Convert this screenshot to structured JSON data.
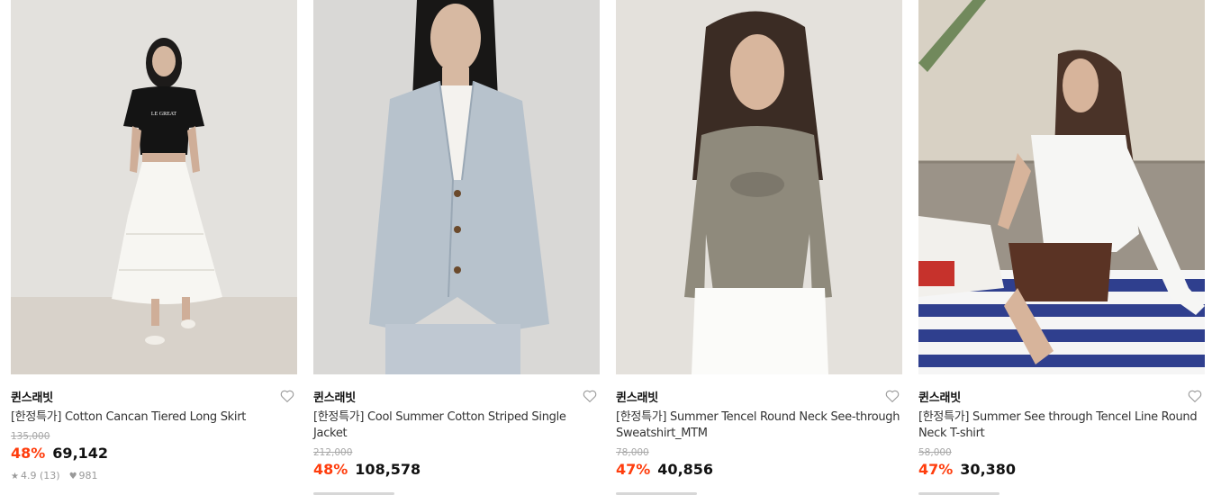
{
  "products": [
    {
      "brand": "퀸스래빗",
      "title": "[한정특가] Cotton Cancan Tiered Long Skirt",
      "original_price": "135,000",
      "discount": "48%",
      "price": "69,142",
      "rating": "4.9",
      "reviews": "(13)",
      "likes": "981",
      "wish_icon": "heart-outline-icon"
    },
    {
      "brand": "퀸스래빗",
      "title": "[한정특가] Cool Summer Cotton Striped Single Jacket",
      "original_price": "212,000",
      "discount": "48%",
      "price": "108,578",
      "wish_icon": "heart-outline-icon"
    },
    {
      "brand": "퀸스래빗",
      "title": "[한정특가] Summer Tencel Round Neck See-through Sweatshirt_MTM",
      "original_price": "78,000",
      "discount": "47%",
      "price": "40,856",
      "wish_icon": "heart-outline-icon"
    },
    {
      "brand": "퀸스래빗",
      "title": "[한정특가] Summer See through Tencel Line Round Neck T-shirt",
      "original_price": "58,000",
      "discount": "47%",
      "price": "30,380",
      "wish_icon": "heart-outline-icon"
    }
  ],
  "colors": {
    "discount": "#ff3d0d",
    "price": "#111111",
    "original_price": "#a8a8a8"
  }
}
